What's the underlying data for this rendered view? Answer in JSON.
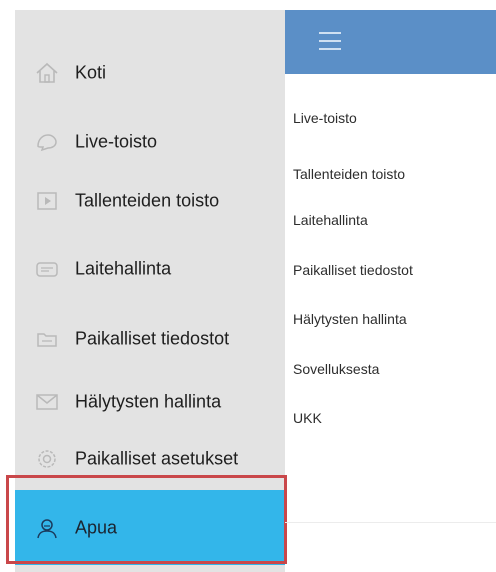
{
  "drawer": {
    "items": [
      {
        "label": "Koti",
        "icon": "home-icon"
      },
      {
        "label": "Live-toisto",
        "icon": "live-view-icon"
      },
      {
        "label": "Tallenteiden toisto",
        "icon": "playback-icon"
      },
      {
        "label": "Laitehallinta",
        "icon": "device-management-icon"
      },
      {
        "label": "Paikalliset tiedostot",
        "icon": "folder-icon"
      },
      {
        "label": "Hälytysten hallinta",
        "icon": "alarm-message-icon"
      },
      {
        "label": "Paikalliset asetukset",
        "icon": "settings-icon"
      },
      {
        "label": "Apua",
        "icon": "help-user-icon",
        "active": true
      }
    ]
  },
  "menu": {
    "items": [
      "Live-toisto",
      "Tallenteiden  toisto",
      "Laitehallinta",
      "Paikalliset  tiedostot",
      "Hälytysten hallinta",
      "Sovelluksesta",
      "UKK"
    ]
  },
  "colors": {
    "drawer_bg": "#e3e3e3",
    "active_bg": "#33b6ea",
    "top_bar": "#5b8fc7",
    "highlight_border": "#c9474a"
  }
}
